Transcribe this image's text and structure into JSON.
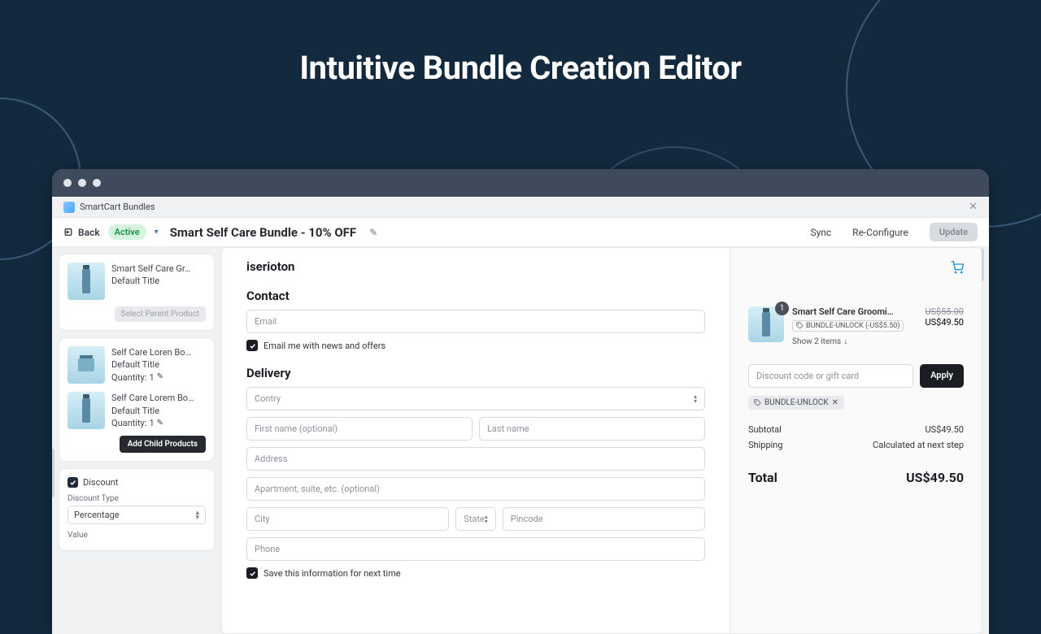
{
  "hero": {
    "title": "Intuitive Bundle Creation Editor"
  },
  "appHeader": {
    "appName": "SmartCart Bundles"
  },
  "toolbar": {
    "back_label": "Back",
    "status": "Active",
    "title": "Smart Self Care Bundle - 10% OFF",
    "sync": "Sync",
    "reconfigure": "Re-Configure",
    "update": "Update"
  },
  "sidebar": {
    "parent": {
      "name": "Smart Self Care Gr…",
      "variant": "Default Title",
      "select_label": "Select Parent Product"
    },
    "children": [
      {
        "name": "Self Care Loren Bo…",
        "variant": "Default Title",
        "qty_label": "Quantity:",
        "qty": "1"
      },
      {
        "name": "Self Care Lorem Bo…",
        "variant": "Default Title",
        "qty_label": "Quantity:",
        "qty": "1"
      }
    ],
    "add_child": "Add Child Products",
    "discount": {
      "checkbox_label": "Discount",
      "type_label": "Discount Type",
      "type_value": "Percentage",
      "value_label": "Value"
    }
  },
  "checkout": {
    "brand": "iserioton",
    "contact_heading": "Contact",
    "email_ph": "Email",
    "news_offers": "Email me with news and offers",
    "delivery_heading": "Delivery",
    "country": "Contry",
    "first_name": "First name (optional)",
    "last_name": "Last name",
    "address": "Address",
    "apt": "Apartment, suite, etc. (optional)",
    "city": "City",
    "state": "State",
    "pincode": "Pincode",
    "phone": "Phone",
    "save_info": "Save this information for next time"
  },
  "summary": {
    "item_name": "Smart Self Care Grooming Co…",
    "qty_badge": "1",
    "discount_tag": "BUNDLE-UNLOCK (-US$5.50)",
    "show_items": "Show 2 items",
    "old_price": "US$55.00",
    "new_price": "US$49.50",
    "dc_placeholder": "Discount code or gift card",
    "apply": "Apply",
    "chip": "BUNDLE-UNLOCK",
    "subtotal_label": "Subtotal",
    "subtotal_value": "US$49.50",
    "shipping_label": "Shipping",
    "shipping_value": "Calculated at next step",
    "total_label": "Total",
    "total_value": "US$49.50"
  }
}
